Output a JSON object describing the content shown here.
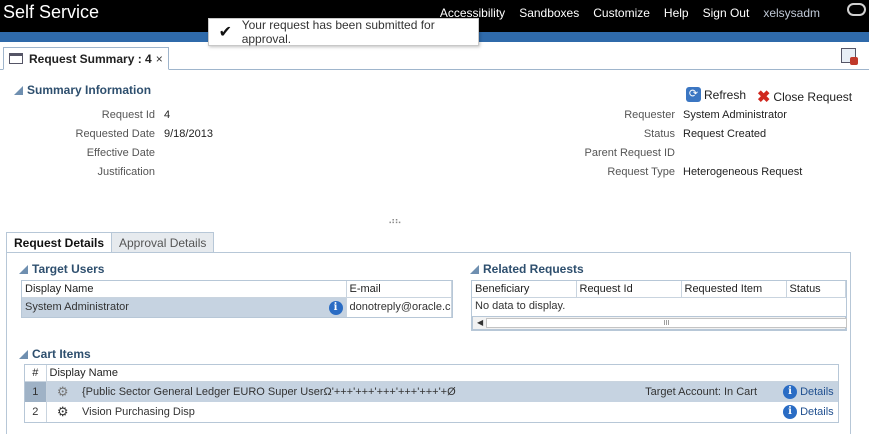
{
  "header": {
    "app_title": "Self Service",
    "nav": [
      "Accessibility",
      "Sandboxes",
      "Customize",
      "Help",
      "Sign Out"
    ],
    "user": "xelsysadm",
    "logo_icon": "oracle-logo-icon"
  },
  "toast": {
    "icon": "checkmark-icon",
    "message": "Your request has been submitted for approval."
  },
  "doc_tab": {
    "label": "Request Summary : 4",
    "close": "×"
  },
  "summary": {
    "title": "Summary Information",
    "actions": {
      "refresh": "Refresh",
      "close_request": "Close Request"
    },
    "left": [
      {
        "label": "Request Id",
        "value": "4"
      },
      {
        "label": "Requested Date",
        "value": "9/18/2013"
      },
      {
        "label": "Effective Date",
        "value": ""
      },
      {
        "label": "Justification",
        "value": ""
      }
    ],
    "right": [
      {
        "label": "Requester",
        "value": "System Administrator"
      },
      {
        "label": "Status",
        "value": "Request Created"
      },
      {
        "label": "Parent Request ID",
        "value": ""
      },
      {
        "label": "Request Type",
        "value": "Heterogeneous Request"
      }
    ]
  },
  "tabs": {
    "active": "Request Details",
    "inactive": "Approval Details"
  },
  "target_users": {
    "title": "Target Users",
    "columns": [
      "Display Name",
      "E-mail"
    ],
    "rows": [
      {
        "display_name": "System Administrator",
        "email": "donotreply@oracle.co"
      }
    ]
  },
  "related_requests": {
    "title": "Related Requests",
    "columns": [
      "Beneficiary",
      "Request Id",
      "Requested Item",
      "Status"
    ],
    "empty_text": "No data to display.",
    "scroll_grip": "III"
  },
  "cart_items": {
    "title": "Cart Items",
    "columns": [
      "#",
      "Display Name"
    ],
    "rows": [
      {
        "num": "1",
        "name": "{Public Sector General Ledger EURO Super UserΩ'+++'+++'+++'+++'+++'+Ø",
        "status": "Target Account: In Cart",
        "details": "Details"
      },
      {
        "num": "2",
        "name": "Vision Purchasing Disp",
        "status": "",
        "details": "Details"
      }
    ]
  }
}
